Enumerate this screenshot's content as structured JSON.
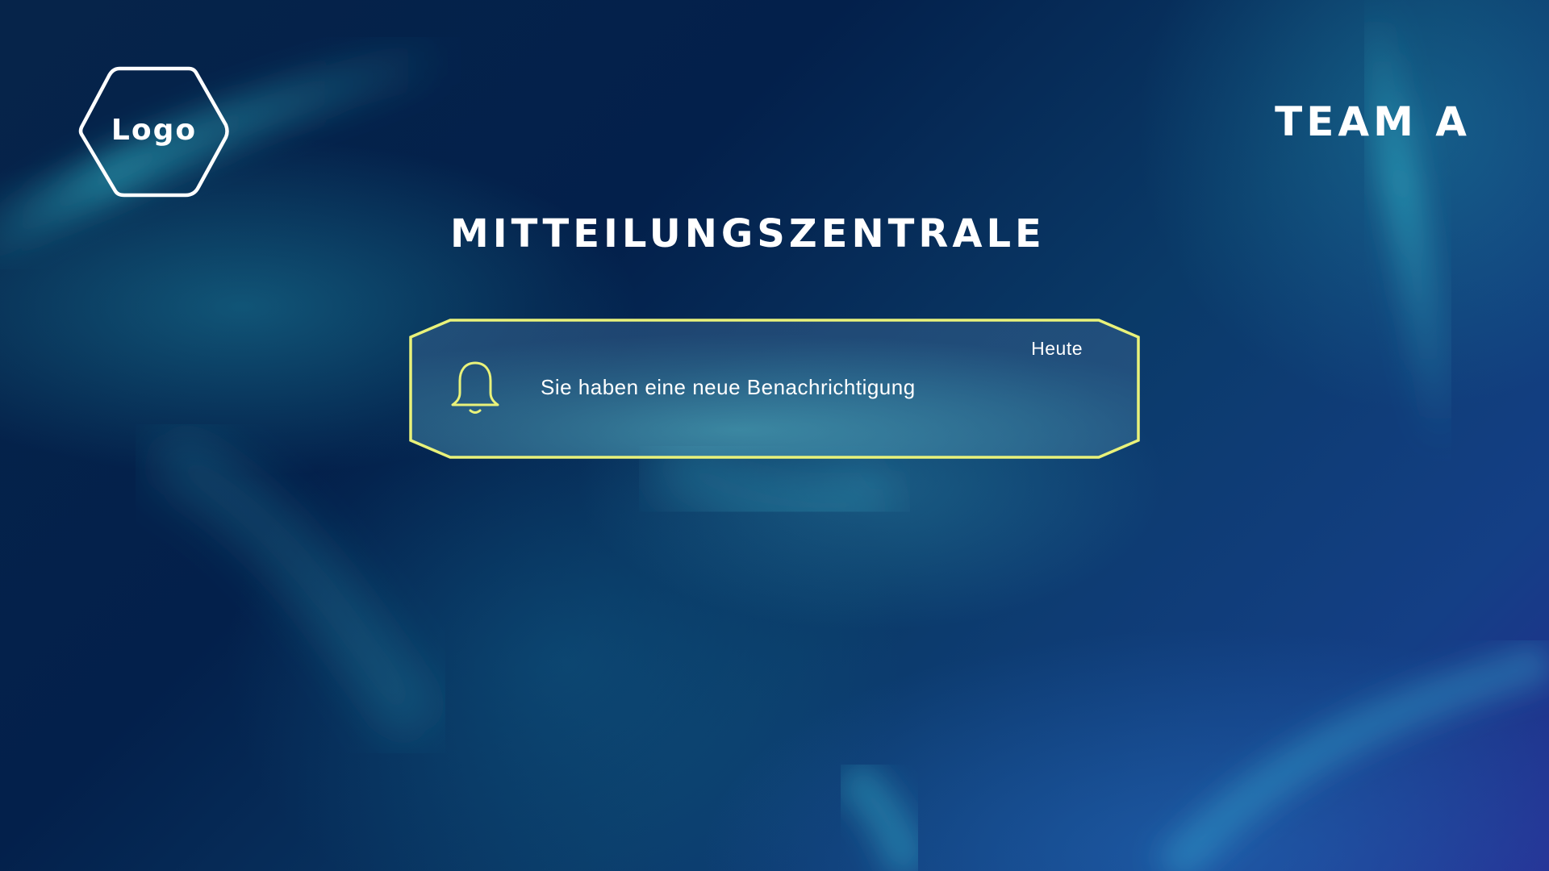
{
  "header": {
    "logo_text": "Logo",
    "team_label": "TEAM A"
  },
  "main": {
    "title": "MITTEILUNGSZENTRALE",
    "notification": {
      "icon": "bell-icon",
      "message": "Sie haben eine neue Benachrichtigung",
      "date": "Heute"
    }
  },
  "colors": {
    "accent": "#e9f27a",
    "text": "#ffffff",
    "background": "#06244a"
  }
}
